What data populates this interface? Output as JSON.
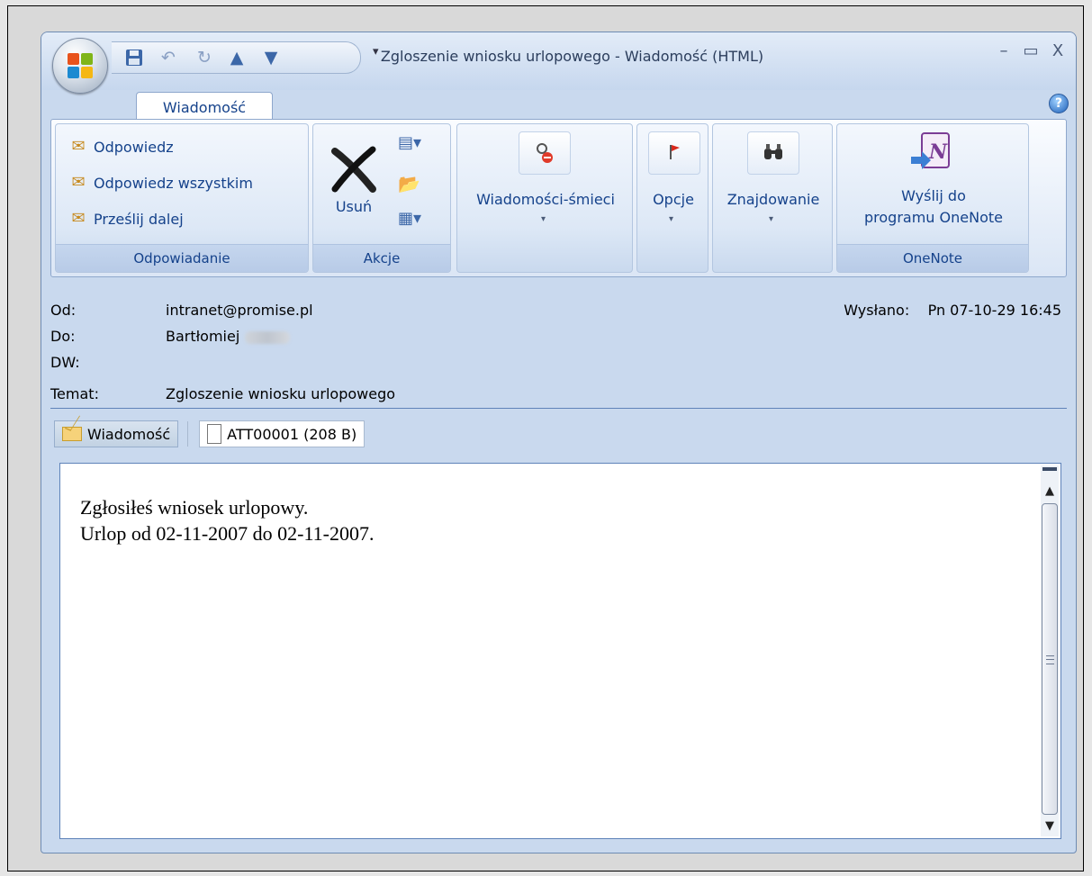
{
  "window": {
    "title": "Zgloszenie wniosku urlopowego - Wiadomość (HTML)",
    "minimize_glyph": "–",
    "maximize_glyph": "▭",
    "close_glyph": "X"
  },
  "qat": {
    "icons": [
      "save-icon",
      "undo-icon",
      "redo-icon",
      "previous-item-icon",
      "next-item-icon"
    ],
    "customize_glyph": "▾"
  },
  "tabs": [
    {
      "label": "Wiadomość",
      "selected": true
    }
  ],
  "help_glyph": "?",
  "ribbon": {
    "groups": {
      "respond": {
        "label": "Odpowiadanie",
        "reply": "Odpowiedz",
        "reply_all": "Odpowiedz wszystkim",
        "forward": "Prześlij dalej"
      },
      "actions": {
        "label": "Akcje",
        "delete": "Usuń"
      },
      "junk": {
        "label": "",
        "button": "Wiadomości-śmieci"
      },
      "options": {
        "label": "",
        "button": "Opcje"
      },
      "find": {
        "label": "",
        "button": "Znajdowanie"
      },
      "onenote": {
        "label": "OneNote",
        "line1": "Wyślij do",
        "line2": "programu OneNote"
      }
    },
    "caret_glyph": "▾"
  },
  "header": {
    "from_label": "Od:",
    "from_value": "intranet@promise.pl",
    "to_label": "Do:",
    "to_value": "Bartłomiej",
    "cc_label": "DW:",
    "cc_value": "",
    "subject_label": "Temat:",
    "subject_value": "Zgloszenie wniosku urlopowego",
    "sent_label": "Wysłano:",
    "sent_value": "Pn 07-10-29 16:45"
  },
  "attachments": {
    "message_tab": "Wiadomość",
    "file": "ATT00001 (208 B)"
  },
  "body": {
    "line1": "Zgłosiłeś wniosek urlopowy.",
    "line2": "Urlop od 02-11-2007 do 02-11-2007."
  },
  "colors": {
    "ribbon_text": "#15428b",
    "window_frame": "#c9d9ee",
    "border_accent": "#5f83b9"
  }
}
